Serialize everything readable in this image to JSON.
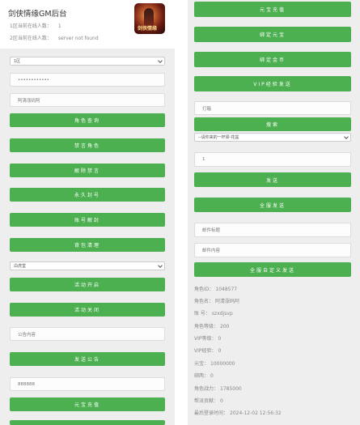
{
  "header": {
    "title": "剑侠情缘GM后台",
    "server1_label": "1区当前在线人数：",
    "server1_value": "1",
    "server2_label": "2区当前在线人数：",
    "server2_value": "server not found",
    "logo_text": "剑侠情缘"
  },
  "left": {
    "server_select": "1区",
    "password_value": "••••••••••••",
    "role_name_value": "阿清涨码阿",
    "btn_query_role": "角色查询",
    "btn_ban_role": "禁言角色",
    "btn_unban": "解除禁言",
    "btn_permaban": "永久封号",
    "btn_unban_account": "账号解封",
    "btn_clear_bag": "背包清理",
    "activity_select": "白虎堂",
    "btn_activity_start": "活动开启",
    "btn_activity_close": "活动关闭",
    "notice_placeholder": "公告内容",
    "btn_send_notice": "发送公告",
    "amount_value": "888888",
    "btn_recharge": "元宝充值"
  },
  "right": {
    "btn_yuanbao": "元宝充值",
    "btn_bound": "绑定元宝",
    "btn_gold": "绑定金币",
    "btn_vip": "VIP经验发送",
    "item_placeholder": "打箱",
    "btn_search": "搜索",
    "item_select": "--请你来的一杯梁-花盆",
    "qty_value": "1",
    "btn_send": "发送",
    "btn_send_all": "全服发送",
    "mail_title_placeholder": "邮件标题",
    "mail_content_placeholder": "邮件内容",
    "btn_send_custom": "全服自定义发送"
  },
  "role_info": [
    {
      "label": "角色ID：",
      "value": "1048577"
    },
    {
      "label": "角色名：",
      "value": "阿清涨码阿"
    },
    {
      "label": "账 号：",
      "value": "szxdjsvp"
    },
    {
      "label": "角色等级：",
      "value": "200"
    },
    {
      "label": "VIP等级：",
      "value": "0"
    },
    {
      "label": "VIP经验：",
      "value": "0"
    },
    {
      "label": "元宝：",
      "value": "10000000"
    },
    {
      "label": "绑两：",
      "value": "0"
    },
    {
      "label": "角色战力：",
      "value": "1785000"
    },
    {
      "label": "帮派贡献：",
      "value": "0"
    },
    {
      "label": "最后登录时间：",
      "value": "2024-12-02 12:56:32"
    }
  ],
  "colors": {
    "button": "#4caf50",
    "panel": "#eeeeee",
    "background": "#ffffff"
  }
}
